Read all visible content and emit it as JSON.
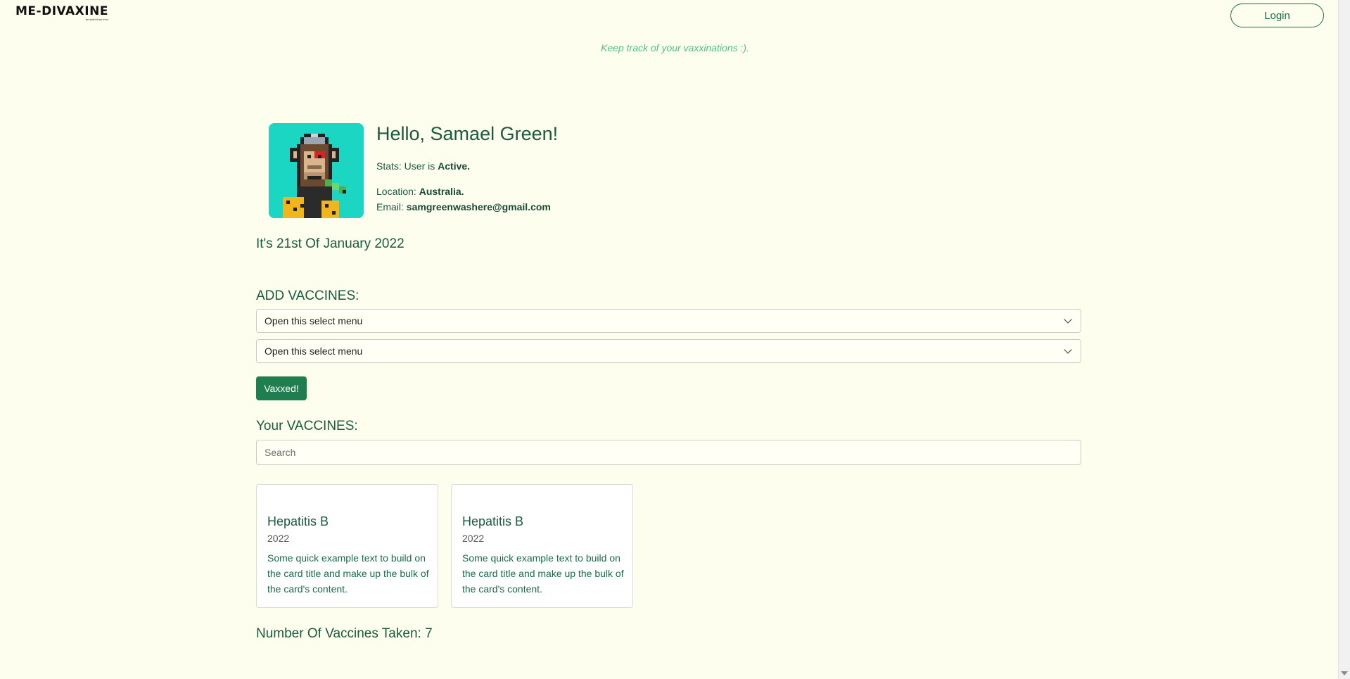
{
  "nav": {
    "brand": "ME-DIVAXINE",
    "tagline": "be safer than ever",
    "login_label": "Login"
  },
  "subtitle": "Keep track of your vaxxinations :).",
  "profile": {
    "greeting": "Hello, Samael Green!",
    "stats_label": "Stats: User is ",
    "stats_value": "Active.",
    "location_label": "Location: ",
    "location_value": "Australia.",
    "email_label": "Email: ",
    "email_value": "samgreenwashere@gmail.com"
  },
  "date_text": "It's 21st Of January 2022",
  "add_section": {
    "heading": "ADD VACCINES:",
    "select1_value": "Open this select menu",
    "select2_value": "Open this select menu",
    "submit_label": "Vaxxed!"
  },
  "your_section": {
    "heading": "Your VACCINES:",
    "search_placeholder": "Search"
  },
  "cards": [
    {
      "title": "Hepatitis B",
      "subtitle": "2022",
      "text": "Some quick example text to build on the card title and make up the bulk of the card's content."
    },
    {
      "title": "Hepatitis B",
      "subtitle": "2022",
      "text": "Some quick example text to build on the card title and make up the bulk of the card's content."
    }
  ],
  "count_text": "Number Of Vaccines Taken: 7",
  "colors": {
    "background": "#fdfeee",
    "primary_green": "#1e7e4f",
    "text_green": "#1a5a3e",
    "subtitle_green": "#4fbf8a",
    "avatar_bg": "#1ad6c3"
  },
  "icons": {
    "avatar": "pixel-ape-avatar",
    "select_arrow": "chevron-down-icon"
  }
}
